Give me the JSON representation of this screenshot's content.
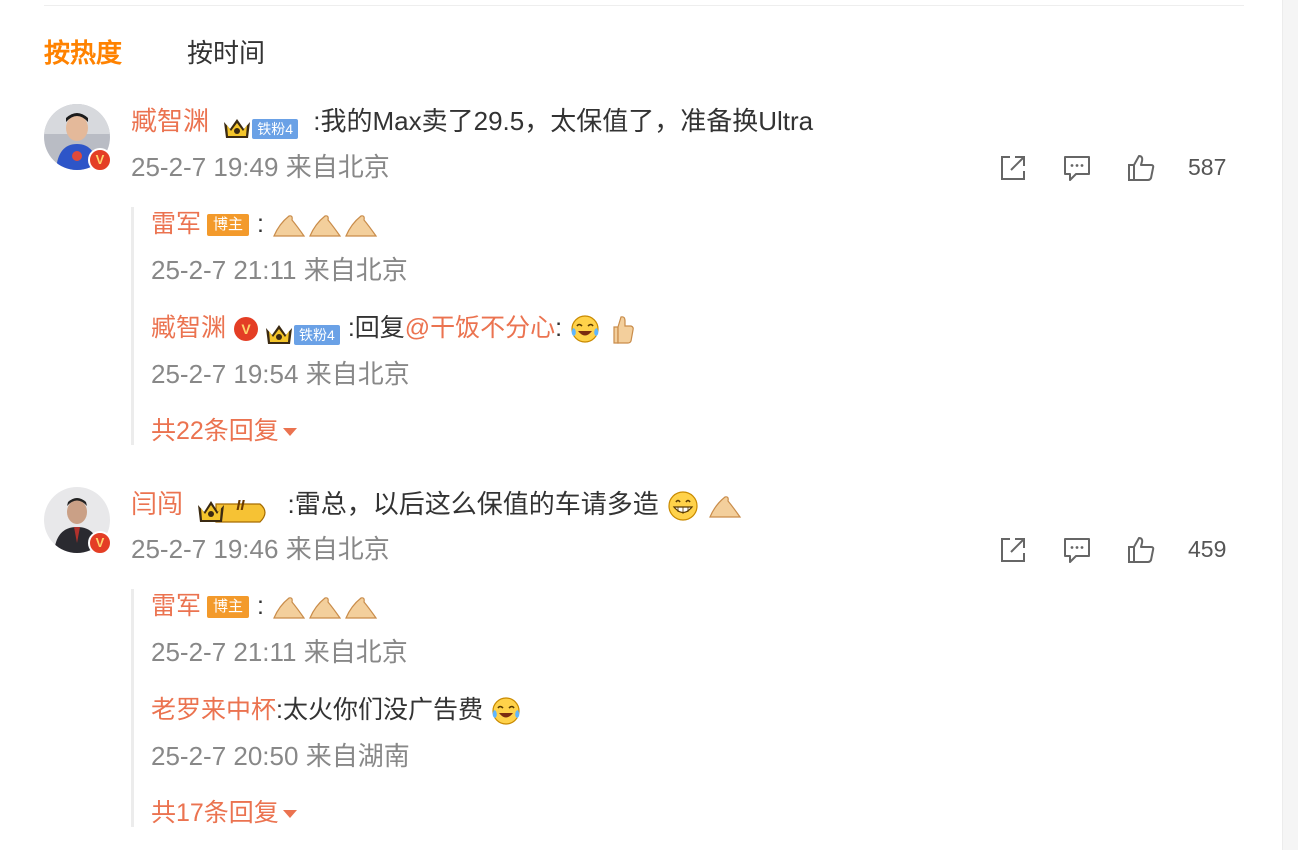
{
  "sort_tabs": {
    "hot": "按热度",
    "time": "按时间"
  },
  "comments": [
    {
      "username": "臧智渊",
      "fan_badge": "铁粉4",
      "text": ":我的Max卖了29.5，太保值了，准备换Ultra",
      "time": "25-2-7 19:49",
      "location": "来自北京",
      "like_count": "587",
      "replies": [
        {
          "username": "雷军",
          "badge": "博主",
          "prefix": ":",
          "time": "25-2-7 21:11",
          "location": "来自北京"
        },
        {
          "username": "臧智渊",
          "fan_badge": "铁粉4",
          "text_a": ":回复",
          "mention": "@干饭不分心",
          "text_b": ":",
          "time": "25-2-7 19:54",
          "location": "来自北京"
        }
      ],
      "more_replies": "共22条回复"
    },
    {
      "username": "闫闯",
      "member_level": "II",
      "text": ":雷总，以后这么保值的车请多造",
      "time": "25-2-7 19:46",
      "location": "来自北京",
      "like_count": "459",
      "replies": [
        {
          "username": "雷军",
          "badge": "博主",
          "prefix": ":",
          "time": "25-2-7 21:11",
          "location": "来自北京"
        },
        {
          "username": "老罗来中杯",
          "text": ":太火你们没广告费",
          "time": "25-2-7 20:50",
          "location": "来自湖南"
        }
      ],
      "more_replies": "共17条回复"
    }
  ],
  "colors": {
    "accent": "#ff8200",
    "username": "#eb7350",
    "meta": "#888888",
    "blogger_badge": "#f39a2b",
    "fan_badge": "#6aa1e6"
  }
}
